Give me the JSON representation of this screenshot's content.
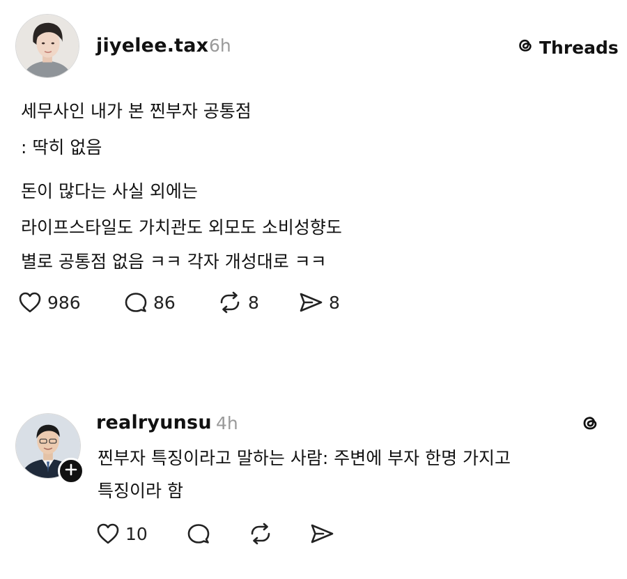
{
  "post": {
    "username": "jiyelee.tax",
    "time": "6h",
    "brand_label": "Threads",
    "lines": [
      "세무사인 내가 본 찐부자 공통점",
      ": 딱히 없음",
      "돈이 많다는 사실 외에는",
      "라이프스타일도 가치관도 외모도 소비성향도",
      "별로 공통점 없음 ㅋㅋ 각자 개성대로 ㅋㅋ"
    ],
    "actions": {
      "likes": "986",
      "replies": "86",
      "reposts": "8",
      "shares": "8"
    }
  },
  "reply": {
    "username": "realryunsu",
    "time": "4h",
    "lines": [
      "찐부자 특징이라고 말하는 사람: 주변에 부자 한명 가지고",
      "특징이라 함"
    ],
    "actions": {
      "likes": "10"
    }
  },
  "icons": {
    "brand": "threads-logo-icon",
    "like": "heart-icon",
    "reply": "speech-bubble-icon",
    "repost": "repost-icon",
    "share": "send-icon",
    "follow": "plus-icon"
  }
}
